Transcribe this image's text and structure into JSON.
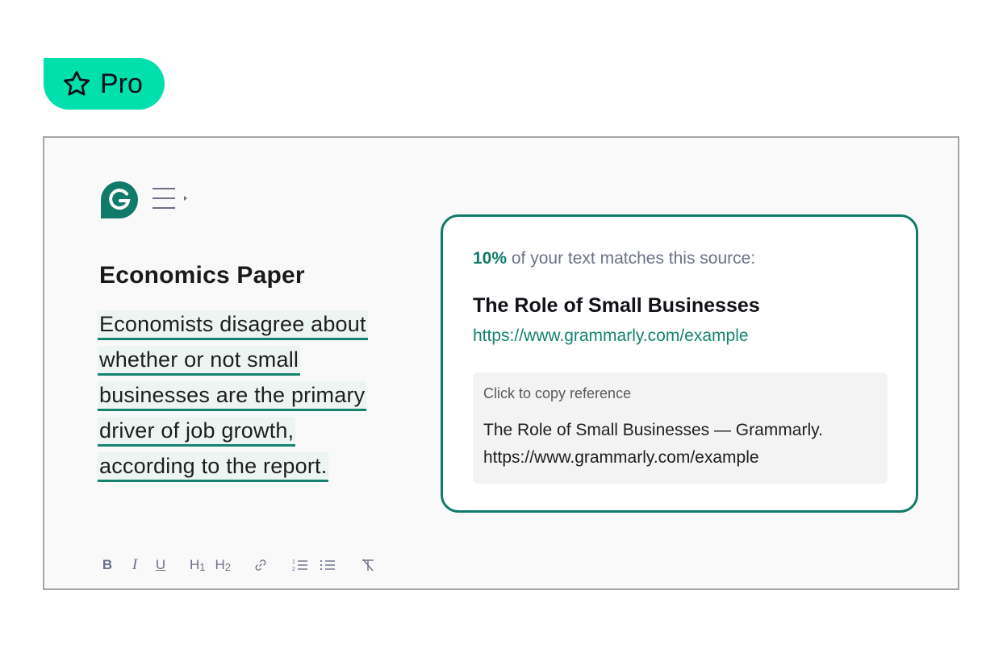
{
  "badge": {
    "icon": "star-outline-icon",
    "label": "Pro",
    "color": "#00e0ac"
  },
  "editor": {
    "logo": "grammarly-g-logo",
    "menu_icon": "menu-expand-icon",
    "title": "Economics Paper",
    "highlighted_lines": [
      "Economists disagree about ",
      "whether or not small ",
      "businesses are the primary",
      "driver of job growth,",
      "according to the report."
    ],
    "toolbar": [
      {
        "name": "bold",
        "label": "B"
      },
      {
        "name": "italic",
        "label": "I"
      },
      {
        "name": "underline",
        "label": "U"
      },
      {
        "name": "heading-1",
        "label": "H1"
      },
      {
        "name": "heading-2",
        "label": "H2"
      },
      {
        "name": "link",
        "label": "link"
      },
      {
        "name": "ordered-list",
        "label": "ordered list"
      },
      {
        "name": "bullet-list",
        "label": "bullet list"
      },
      {
        "name": "clear-formatting",
        "label": "clear formatting"
      }
    ]
  },
  "plagiarism_card": {
    "percent": "10%",
    "match_text": " of your text matches this source:",
    "source_title": "The Role of Small Businesses",
    "source_url": "https://www.grammarly.com/example",
    "copy_label": "Click to copy reference",
    "reference_line1": "The Role of Small Businesses — Grammarly.",
    "reference_line2": "https://www.grammarly.com/example",
    "accent": "#117a6a"
  }
}
